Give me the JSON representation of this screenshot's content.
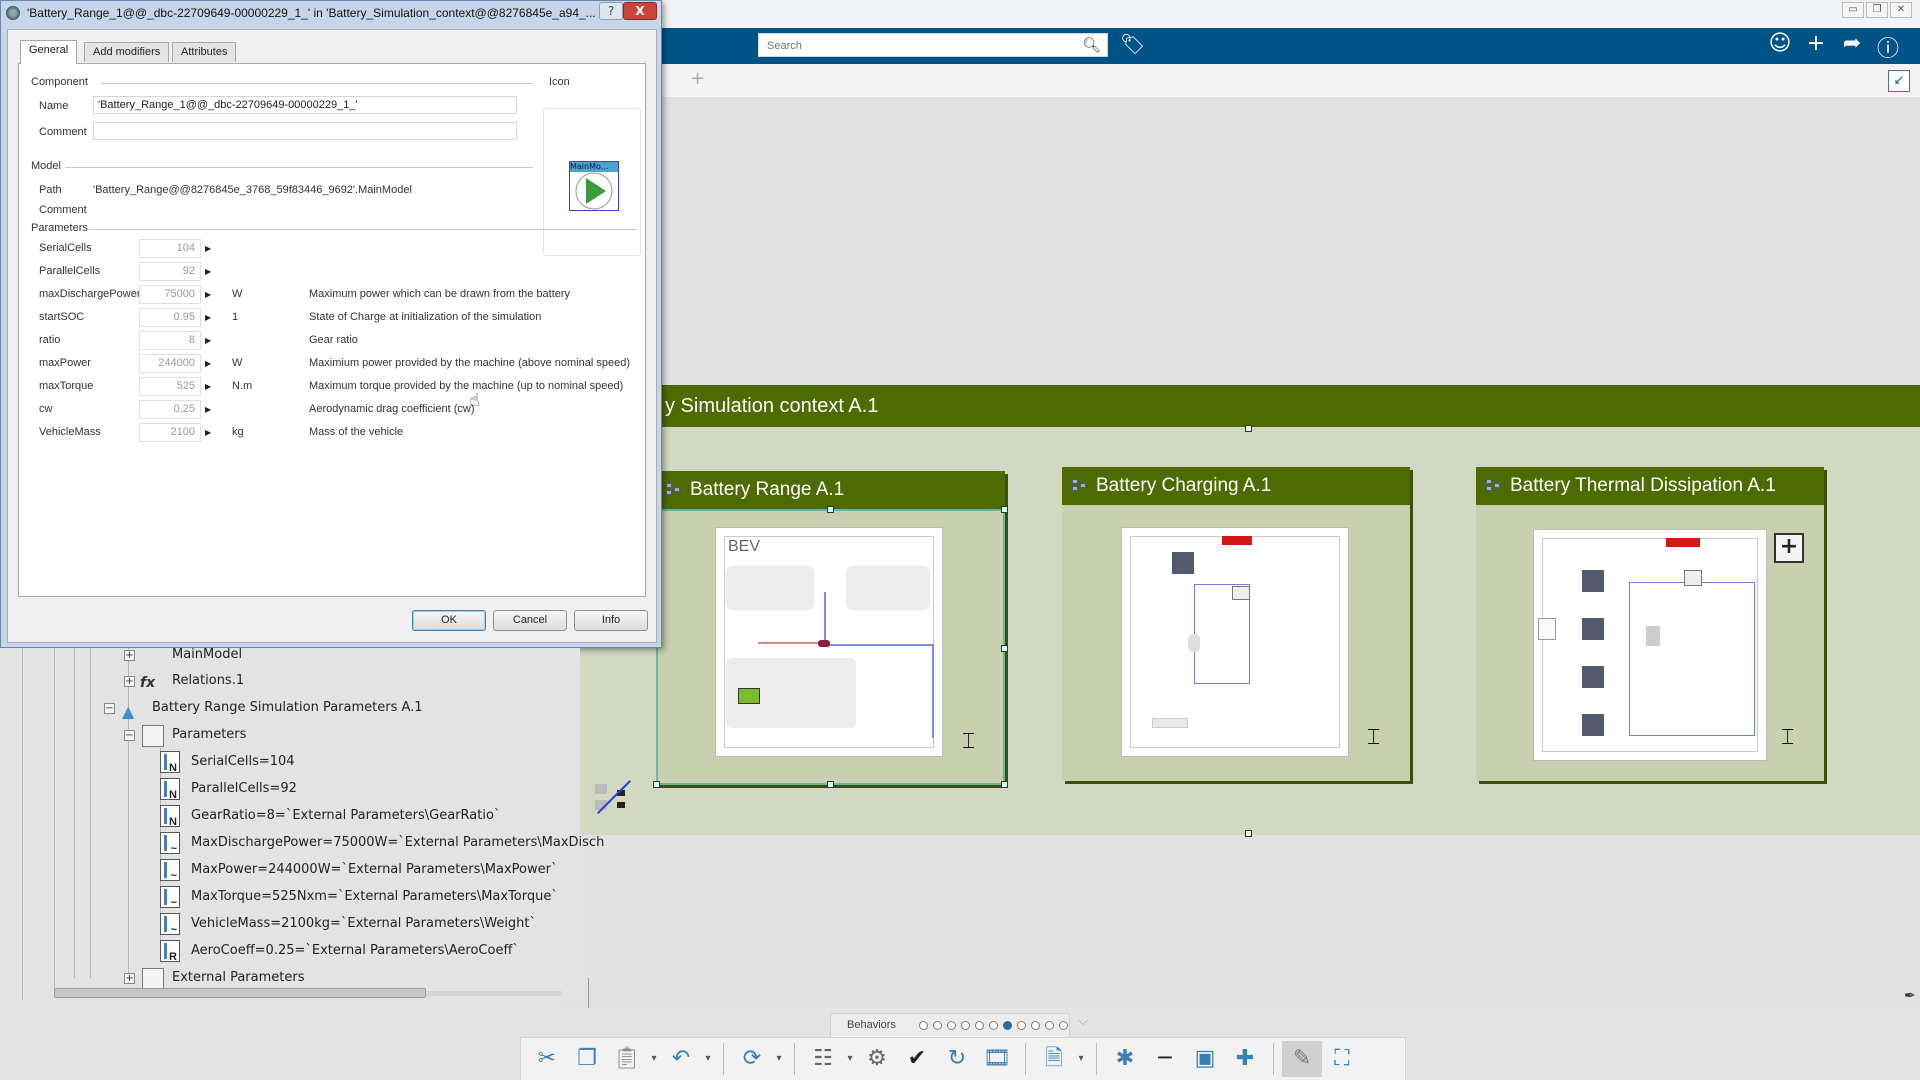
{
  "dialog": {
    "title": "'Battery_Range_1@@_dbc-22709649-00000229_1_' in 'Battery_Simulation_context@@8276845e_a94_...",
    "help_label": "?",
    "close_label": "X",
    "tabs": [
      {
        "label": "General",
        "active": true
      },
      {
        "label": "Add modifiers",
        "active": false
      },
      {
        "label": "Attributes",
        "active": false
      }
    ],
    "component_group": "Component",
    "name_label": "Name",
    "name_value": "'Battery_Range_1@@_dbc-22709649-00000229_1_'",
    "comment_label": "Comment",
    "comment_value": "",
    "icon_group": "Icon",
    "icon_caption": "MainMo...",
    "model_group": "Model",
    "path_label": "Path",
    "path_value": "'Battery_Range@@8276845e_3768_59f83446_9692'.MainModel",
    "model_comment_label": "Comment",
    "parameters_group": "Parameters",
    "parameters": [
      {
        "name": "SerialCells",
        "value": "104",
        "unit": "",
        "description": ""
      },
      {
        "name": "ParallelCells",
        "value": "92",
        "unit": "",
        "description": ""
      },
      {
        "name": "maxDischargePower",
        "value": "75000",
        "unit": "W",
        "description": "Maximum power which can be drawn from the battery"
      },
      {
        "name": "startSOC",
        "value": "0.95",
        "unit": "1",
        "description": "State of Charge at initialization of the simulation"
      },
      {
        "name": "ratio",
        "value": "8",
        "unit": "",
        "description": "Gear ratio"
      },
      {
        "name": "maxPower",
        "value": "244000",
        "unit": "W",
        "description": "Maximium power provided by the machine (above nominal speed)"
      },
      {
        "name": "maxTorque",
        "value": "525",
        "unit": "N.m",
        "description": "Maximum torque provided by the machine (up to nominal speed)"
      },
      {
        "name": "cw",
        "value": "0.25",
        "unit": "",
        "description": "Aerodynamic drag coefficient (cw)"
      },
      {
        "name": "VehicleMass",
        "value": "2100",
        "unit": "kg",
        "description": "Mass of the vehicle"
      }
    ],
    "buttons": {
      "ok": "OK",
      "cancel": "Cancel",
      "info": "Info"
    }
  },
  "topbar": {
    "search_placeholder": "Search",
    "icons": [
      "search-icon",
      "tag-icon",
      "user-icon",
      "add-icon",
      "share-icon",
      "help-icon"
    ]
  },
  "window_controls": {
    "minimize": "▭",
    "restore": "❐",
    "close": "✕"
  },
  "tabstrip": {
    "add_label": "+"
  },
  "canvas": {
    "context_title": "y Simulation context A.1",
    "cards": [
      {
        "title": "Battery Range A.1",
        "diagram_label": "BEV"
      },
      {
        "title": "Battery Charging A.1"
      },
      {
        "title": "Battery Thermal Dissipation A.1",
        "expand_label": "+"
      }
    ]
  },
  "tree": {
    "items": [
      {
        "label": "MainModel",
        "level": 1
      },
      {
        "label": "Relations.1",
        "level": 1
      },
      {
        "label": "Battery Range Simulation Parameters A.1",
        "level": 0
      },
      {
        "label": "Parameters",
        "level": 1
      },
      {
        "label": "SerialCells=104",
        "level": 2
      },
      {
        "label": "ParallelCells=92",
        "level": 2
      },
      {
        "label": "GearRatio=8=`External Parameters\\GearRatio`",
        "level": 2
      },
      {
        "label": "MaxDischargePower=75000W=`External Parameters\\MaxDisch",
        "level": 2
      },
      {
        "label": "MaxPower=244000W=`External Parameters\\MaxPower`",
        "level": 2
      },
      {
        "label": "MaxTorque=525Nxm=`External Parameters\\MaxTorque`",
        "level": 2
      },
      {
        "label": "VehicleMass=2100kg=`External Parameters\\Weight`",
        "level": 2
      },
      {
        "label": "AeroCoeff=0.25=`External Parameters\\AeroCoeff`",
        "level": 2
      },
      {
        "label": "External Parameters",
        "level": 1
      }
    ]
  },
  "behaviors": {
    "label": "Behaviors",
    "page_count": 11,
    "active_page": 7
  },
  "colors": {
    "brand_blue": "#005386",
    "context_green": "#4d6b01",
    "panel_green": "#d2d8c2",
    "close_red": "#c9443a"
  }
}
